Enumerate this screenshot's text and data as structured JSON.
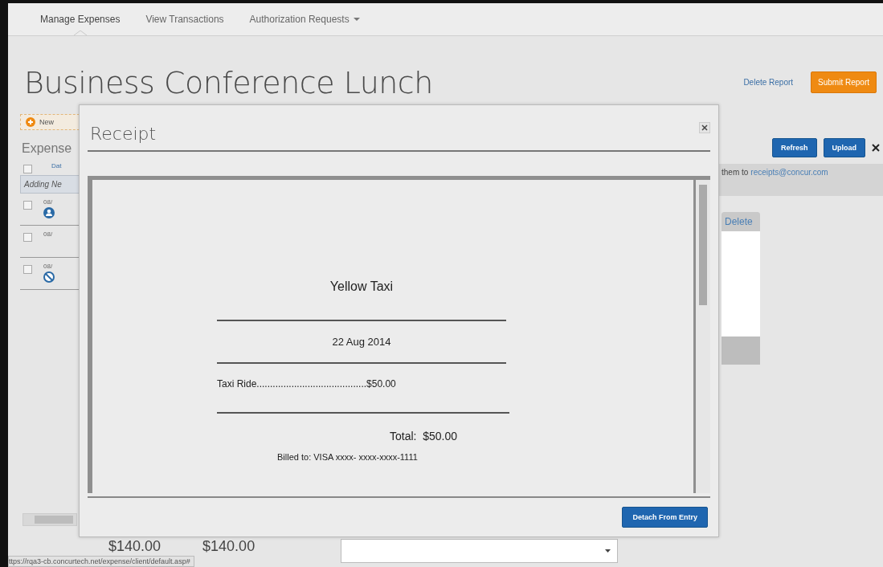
{
  "nav": {
    "tabs": [
      {
        "label": "Manage Expenses",
        "selected": true,
        "dropdown": false
      },
      {
        "label": "View Transactions",
        "selected": false,
        "dropdown": false
      },
      {
        "label": "Authorization Requests",
        "selected": false,
        "dropdown": true
      }
    ]
  },
  "report": {
    "title": "Business Conference Lunch",
    "actions": [
      {
        "label": "Delete Report",
        "kind": "link"
      },
      {
        "label": "Submit Report",
        "kind": "primary"
      }
    ]
  },
  "expenses": {
    "new_button": "New",
    "select_all_checked": false,
    "heading": "Expense",
    "column_header": "Dat",
    "adding_row": "Adding Ne",
    "rows": [
      {
        "date": "08/",
        "checked": false,
        "kind": "person"
      },
      {
        "date": "08/",
        "checked": false,
        "kind": "plain"
      },
      {
        "date": "08/",
        "checked": false,
        "kind": "blocked"
      }
    ],
    "totals": [
      "$140.00",
      "$140.00"
    ]
  },
  "receipts_panel": {
    "buttons": [
      "Refresh",
      "Upload"
    ],
    "message": "them to",
    "email": "receipts@concur.com",
    "column": "Delete"
  },
  "dialog": {
    "title": "Receipt",
    "receipt": {
      "merchant": "Yellow Taxi",
      "date": "22 Aug 2014",
      "item": "Taxi Ride.........................................$50.00",
      "total": "Total:  $50.00",
      "billed_to": "Billed to: VISA xxxx- xxxx-xxxx-1111"
    },
    "button": "Detach From Entry"
  },
  "status_bar": {
    "url": "ttps://rqa3-cb.concurtech.net/expense/client/default.asp#"
  }
}
